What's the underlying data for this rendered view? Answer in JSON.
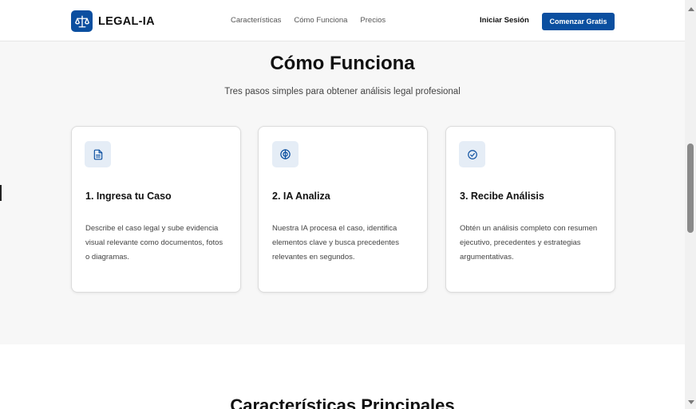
{
  "header": {
    "brand": "LEGAL-IA",
    "nav": [
      "Características",
      "Cómo Funciona",
      "Precios"
    ],
    "login_label": "Iniciar Sesión",
    "cta_label": "Comenzar Gratis"
  },
  "how_it_works": {
    "title": "Cómo Funciona",
    "subtitle": "Tres pasos simples para obtener análisis legal profesional",
    "steps": [
      {
        "icon": "document-icon",
        "title": "1. Ingresa tu Caso",
        "description": "Describe el caso legal y sube evidencia visual relevante como documentos, fotos o diagramas."
      },
      {
        "icon": "brain-icon",
        "title": "2. IA Analiza",
        "description": "Nuestra IA procesa el caso, identifica elementos clave y busca precedentes relevantes en segundos."
      },
      {
        "icon": "check-circle-icon",
        "title": "3. Recibe Análisis",
        "description": "Obtén un análisis completo con resumen ejecutivo, precedentes y estrategias argumentativas."
      }
    ]
  },
  "features": {
    "title": "Características Principales"
  },
  "colors": {
    "brand": "#0b4fa0",
    "icon_bg": "#e5edf6",
    "page_bg": "#f7f7f7"
  }
}
